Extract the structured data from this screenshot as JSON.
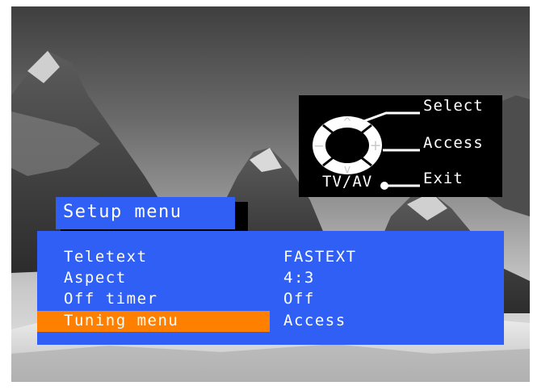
{
  "remote_guide": {
    "select_label": "Select",
    "access_label": "Access",
    "exit_label": "Exit",
    "tvav_label": "TV/AV",
    "up_symbol": "^",
    "down_symbol": "v",
    "left_symbol": "−",
    "right_symbol": "+"
  },
  "menu": {
    "title": "Setup menu",
    "items": [
      {
        "label": "Teletext",
        "value": "FASTEXT",
        "selected": false
      },
      {
        "label": "Aspect",
        "value": "4:3",
        "selected": false
      },
      {
        "label": "Off timer",
        "value": "Off",
        "selected": false
      },
      {
        "label": "Tuning menu",
        "value": "Access",
        "selected": true
      }
    ]
  },
  "colors": {
    "panel_blue": "#2f5ff5",
    "highlight_orange": "#ff7f00",
    "guide_background": "#000000",
    "text": "#ffffff"
  }
}
